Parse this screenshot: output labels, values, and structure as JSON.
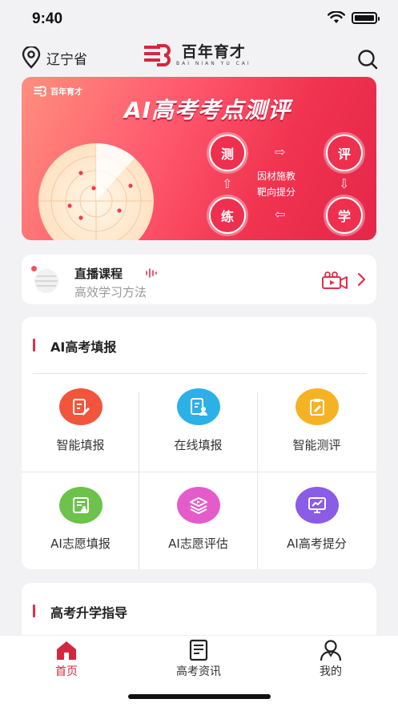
{
  "status_bar": {
    "time": "9:40"
  },
  "header": {
    "location": "辽宁省",
    "logo_cn": "百年育才",
    "logo_en": "BAI NIAN YU CAI"
  },
  "banner": {
    "brand": "百年育才",
    "title": "AI高考考点测评",
    "steps": [
      "测",
      "评",
      "学",
      "练"
    ],
    "center_lines": [
      "因材施教",
      "靶向提分"
    ],
    "accent": "#ef2f4e"
  },
  "live": {
    "title": "直播课程",
    "subtitle": "高效学习方法"
  },
  "ai_section": {
    "title": "AI高考填报",
    "items": [
      {
        "label": "智能填报",
        "icon": "edit-doc-icon",
        "color": "#f2553c"
      },
      {
        "label": "在线填报",
        "icon": "user-doc-icon",
        "color": "#2bb0e8"
      },
      {
        "label": "智能测评",
        "icon": "clipboard-pen-icon",
        "color": "#f5b324"
      },
      {
        "label": "AI志愿填报",
        "icon": "form-user-icon",
        "color": "#6cc24a"
      },
      {
        "label": "AI志愿评估",
        "icon": "layers-play-icon",
        "color": "#e45cc9"
      },
      {
        "label": "AI高考提分",
        "icon": "monitor-chart-icon",
        "color": "#8b5ce6"
      }
    ]
  },
  "guide_section": {
    "title": "高考升学指导"
  },
  "tabbar": {
    "tabs": [
      {
        "label": "首页",
        "icon": "home-icon",
        "active": true
      },
      {
        "label": "高考资讯",
        "icon": "news-icon",
        "active": false
      },
      {
        "label": "我的",
        "icon": "profile-icon",
        "active": false
      }
    ],
    "active_color": "#d2283f"
  }
}
